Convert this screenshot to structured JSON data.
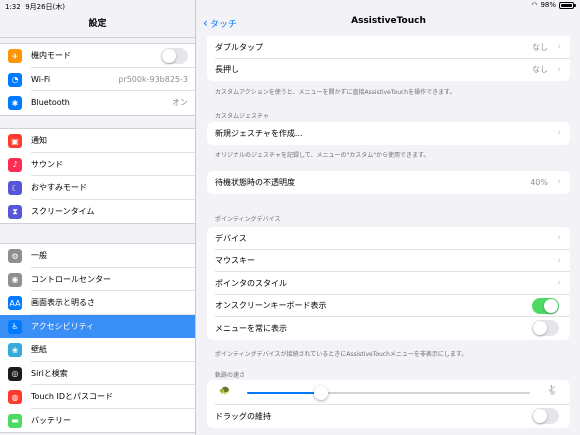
{
  "status": {
    "time": "1:32",
    "date": "9月26日(木)",
    "battery": "98%",
    "battery_level": 0.98
  },
  "sidebar": {
    "title": "設定",
    "group1": [
      {
        "label": "機内モード",
        "icon": "airplane-icon",
        "color": "#ff9500",
        "glyph": "✈",
        "toggle": "off"
      },
      {
        "label": "Wi-Fi",
        "icon": "wifi-icon",
        "color": "#007aff",
        "glyph": "◔",
        "value": "pr500k-93b825-3"
      },
      {
        "label": "Bluetooth",
        "icon": "bluetooth-icon",
        "color": "#007aff",
        "glyph": "✱",
        "value": "オン"
      }
    ],
    "group2": [
      {
        "label": "通知",
        "icon": "notifications-icon",
        "color": "#ff3b30",
        "glyph": "▣"
      },
      {
        "label": "サウンド",
        "icon": "sounds-icon",
        "color": "#ff2d55",
        "glyph": "♪"
      },
      {
        "label": "おやすみモード",
        "icon": "do-not-disturb-icon",
        "color": "#5856d6",
        "glyph": "☾"
      },
      {
        "label": "スクリーンタイム",
        "icon": "screen-time-icon",
        "color": "#5856d6",
        "glyph": "⧗"
      }
    ],
    "group3": [
      {
        "label": "一般",
        "icon": "general-icon",
        "color": "#8e8e93",
        "glyph": "⚙"
      },
      {
        "label": "コントロールセンター",
        "icon": "control-center-icon",
        "color": "#8e8e93",
        "glyph": "◉"
      },
      {
        "label": "画面表示と明るさ",
        "icon": "display-icon",
        "color": "#007aff",
        "glyph": "AA"
      },
      {
        "label": "アクセシビリティ",
        "icon": "accessibility-icon",
        "color": "#007aff",
        "glyph": "♿",
        "selected": true
      },
      {
        "label": "壁紙",
        "icon": "wallpaper-icon",
        "color": "#34aadc",
        "glyph": "❀"
      },
      {
        "label": "Siriと検索",
        "icon": "siri-icon",
        "color": "#1c1c1e",
        "glyph": "◎"
      },
      {
        "label": "Touch IDとパスコード",
        "icon": "touch-id-icon",
        "color": "#ff3b30",
        "glyph": "◍"
      },
      {
        "label": "バッテリー",
        "icon": "battery-icon",
        "color": "#4cd964",
        "glyph": "▬"
      }
    ]
  },
  "main": {
    "back_label": "タッチ",
    "title": "AssistiveTouch",
    "custom_actions": [
      {
        "label": "ダブルタップ",
        "value": "なし"
      },
      {
        "label": "長押し",
        "value": "なし"
      }
    ],
    "custom_actions_footer": "カスタムアクションを使うと、メニューを開かずに直接AssistiveTouchを操作できます。",
    "custom_gestures_header": "カスタムジェスチャ",
    "new_gesture_label": "新規ジェスチャを作成...",
    "custom_gestures_footer": "オリジナルのジェスチャを記録して、メニューの\"カスタム\"から使用できます。",
    "idle_opacity_label": "待機状態時の不透明度",
    "idle_opacity_value": "40%",
    "pointing_header": "ポインティングデバイス",
    "pointing": [
      {
        "label": "デバイス"
      },
      {
        "label": "マウスキー"
      },
      {
        "label": "ポインタのスタイル"
      },
      {
        "label": "オンスクリーンキーボード表示",
        "toggle": "on"
      },
      {
        "label": "メニューを常に表示",
        "toggle": "off"
      }
    ],
    "pointing_footer": "ポインティングデバイスが接続されているときにAssistiveTouchメニューを非表示にします。",
    "tracking_header": "軌跡の速さ",
    "tracking_speed": 0.26,
    "drag_lock_label": "ドラッグの維持",
    "drag_lock_toggle": "off"
  }
}
